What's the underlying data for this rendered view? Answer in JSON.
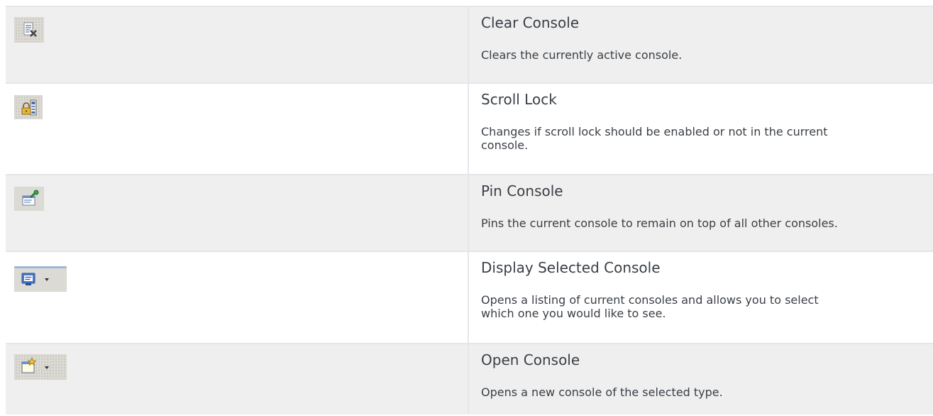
{
  "rows": [
    {
      "icon": "clear-console-icon",
      "title": "Clear Console",
      "description": "Clears the currently active console."
    },
    {
      "icon": "scroll-lock-icon",
      "title": "Scroll Lock",
      "description": "Changes if scroll lock should be enabled or not in the current console."
    },
    {
      "icon": "pin-console-icon",
      "title": "Pin Console",
      "description": "Pins the current console to remain on top of all other consoles."
    },
    {
      "icon": "display-selected-console-icon",
      "title": "Display Selected Console",
      "description": "Opens a listing of current consoles and allows you to select which one you would like to see."
    },
    {
      "icon": "open-console-icon",
      "title": "Open Console",
      "description": "Opens a new console of the selected type."
    }
  ],
  "colors": {
    "row_shade": "#efefef",
    "row_plain": "#ffffff",
    "border": "#e4e6ea",
    "text": "#3a3f45"
  }
}
